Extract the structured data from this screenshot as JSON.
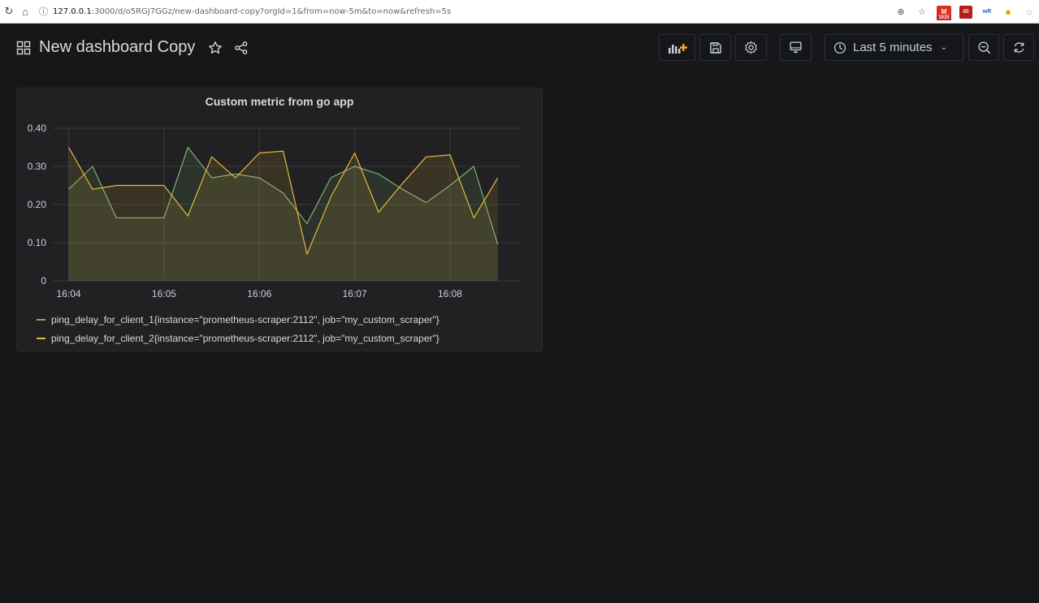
{
  "browser": {
    "host": "127.0.0.1",
    "url_rest": ":3000/d/o5RGJ7GGz/new-dashboard-copy?orgId=1&from=now-5m&to=now&refresh=5s",
    "gmail_count": "1025"
  },
  "header": {
    "title": "New dashboard Copy",
    "time_range": "Last 5 minutes"
  },
  "panel": {
    "title": "Custom metric from go app"
  },
  "colors": {
    "series1": "#7eb26d",
    "series2": "#eab839",
    "grid": "#3a3b3e"
  },
  "chart_data": {
    "type": "line",
    "title": "Custom metric from go app",
    "xlabel": "",
    "ylabel": "",
    "ylim": [
      0,
      0.4
    ],
    "y_ticks": [
      "0",
      "0.10",
      "0.20",
      "0.30",
      "0.40"
    ],
    "x_ticks": [
      "16:04",
      "16:05",
      "16:06",
      "16:07",
      "16:08"
    ],
    "x_tick_times": [
      "16:04:00",
      "16:05:00",
      "16:06:00",
      "16:07:00",
      "16:08:00"
    ],
    "xlim": [
      "16:03:50",
      "16:08:45"
    ],
    "grid": true,
    "legend_position": "bottom",
    "series": [
      {
        "name": "ping_delay_for_client_1{instance=\"prometheus-scraper:2112\", job=\"my_custom_scraper\"}",
        "x": [
          "16:04:00",
          "16:04:15",
          "16:04:30",
          "16:05:00",
          "16:05:15",
          "16:05:30",
          "16:05:45",
          "16:06:00",
          "16:06:15",
          "16:06:30",
          "16:06:45",
          "16:07:00",
          "16:07:15",
          "16:07:30",
          "16:07:45",
          "16:08:00",
          "16:08:15",
          "16:08:30"
        ],
        "values": [
          0.24,
          0.3,
          0.165,
          0.165,
          0.35,
          0.27,
          0.28,
          0.27,
          0.23,
          0.15,
          0.27,
          0.3,
          0.28,
          0.24,
          0.205,
          0.25,
          0.3,
          0.095
        ]
      },
      {
        "name": "ping_delay_for_client_2{instance=\"prometheus-scraper:2112\", job=\"my_custom_scraper\"}",
        "x": [
          "16:04:00",
          "16:04:15",
          "16:04:30",
          "16:05:00",
          "16:05:15",
          "16:05:30",
          "16:05:45",
          "16:06:00",
          "16:06:15",
          "16:06:30",
          "16:06:45",
          "16:07:00",
          "16:07:15",
          "16:07:30",
          "16:07:45",
          "16:08:00",
          "16:08:15",
          "16:08:30"
        ],
        "values": [
          0.35,
          0.24,
          0.25,
          0.25,
          0.17,
          0.325,
          0.27,
          0.335,
          0.34,
          0.07,
          0.22,
          0.335,
          0.18,
          0.255,
          0.325,
          0.33,
          0.165,
          0.27
        ]
      }
    ]
  }
}
